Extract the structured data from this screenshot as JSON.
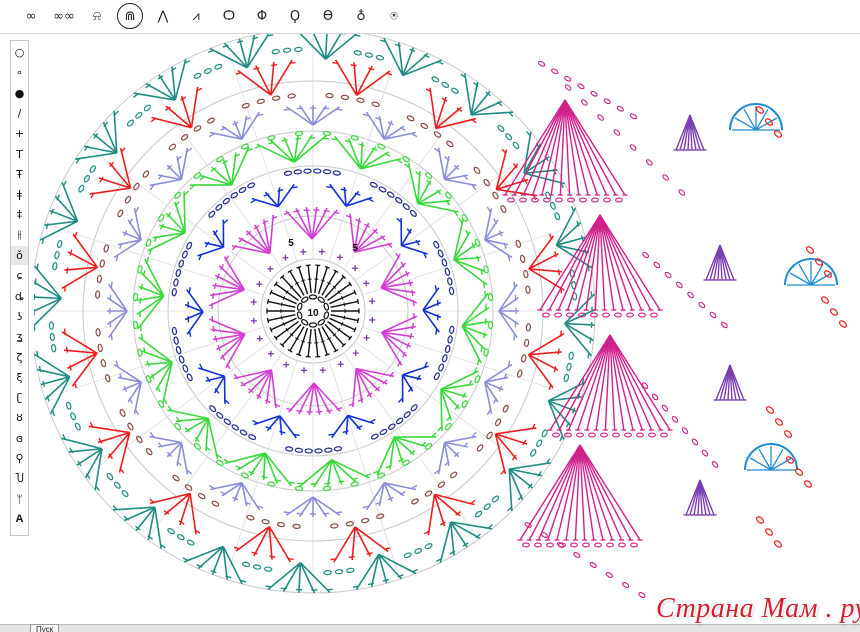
{
  "toolbar": {
    "top_tools": [
      {
        "icon": "chain-icon",
        "glyph": "∞"
      },
      {
        "icon": "long-chain-icon",
        "glyph": "∞∞"
      },
      {
        "icon": "shell-icon",
        "glyph": "⍾"
      },
      {
        "icon": "puff-stitch-icon",
        "glyph": "⋒",
        "selected": true
      },
      {
        "icon": "decrease-icon",
        "glyph": "⋀"
      },
      {
        "icon": "triple-decrease-icon",
        "glyph": "⩘"
      },
      {
        "icon": "bobble-icon",
        "glyph": "Ѻ"
      },
      {
        "icon": "popcorn-icon",
        "glyph": "Φ"
      },
      {
        "icon": "cluster-3-icon",
        "glyph": "Ϙ"
      },
      {
        "icon": "cluster-4-icon",
        "glyph": "Ѳ"
      },
      {
        "icon": "cluster-5-icon",
        "glyph": "♁"
      },
      {
        "icon": "cluster-6-icon",
        "glyph": "⍟"
      }
    ],
    "side_tools": [
      {
        "icon": "slip-stitch-icon",
        "glyph": "○"
      },
      {
        "icon": "small-chain-icon",
        "glyph": "∘"
      },
      {
        "icon": "filled-dot-icon",
        "glyph": "●"
      },
      {
        "icon": "line-icon",
        "glyph": "/"
      },
      {
        "icon": "single-crochet-icon",
        "glyph": "+"
      },
      {
        "icon": "half-double-icon",
        "glyph": "T"
      },
      {
        "icon": "double-crochet-icon",
        "glyph": "Ŧ"
      },
      {
        "icon": "treble-icon",
        "glyph": "ǂ"
      },
      {
        "icon": "double-treble-icon",
        "glyph": "‡"
      },
      {
        "icon": "triple-treble-icon",
        "glyph": "⫲"
      },
      {
        "icon": "post-stitch-icon",
        "glyph": "ǒ",
        "selected": true
      },
      {
        "icon": "front-post-icon",
        "glyph": "ɕ"
      },
      {
        "icon": "back-post-icon",
        "glyph": "ȡ"
      },
      {
        "icon": "hook-icon",
        "glyph": "ʖ"
      },
      {
        "icon": "curl-icon",
        "glyph": "ʓ"
      },
      {
        "icon": "spiral-icon",
        "glyph": "ζ"
      },
      {
        "icon": "double-spiral-icon",
        "glyph": "ξ"
      },
      {
        "icon": "loop-icon",
        "glyph": "ʗ"
      },
      {
        "icon": "twist-icon",
        "glyph": "ȣ"
      },
      {
        "icon": "knot-icon",
        "glyph": "ɞ"
      },
      {
        "icon": "anchor-icon",
        "glyph": "⚲"
      },
      {
        "icon": "bracket-icon",
        "glyph": "Ⴎ"
      },
      {
        "icon": "spike-icon",
        "glyph": "ᛘ"
      },
      {
        "icon": "text-tool-icon",
        "glyph": "A"
      }
    ]
  },
  "chart_labels": {
    "center_count": "10",
    "round_two_left": "5",
    "round_two_right": "5"
  },
  "colors": {
    "center": "#111111",
    "purple": "#7a3fb0",
    "magenta": "#d23fd2",
    "navy": "#1e2a90",
    "blue": "#1030d8",
    "green": "#38d83a",
    "lavender": "#8a8ed8",
    "red": "#ee1c1c",
    "brown": "#8a4b40",
    "teal": "#1e8c82",
    "pink_magenta": "#d0208a",
    "cyan": "#1e8ccf",
    "guide": "#c8c8c8"
  },
  "status": {
    "start_label": "Пуск"
  },
  "watermark": "Страна Мам . ру"
}
